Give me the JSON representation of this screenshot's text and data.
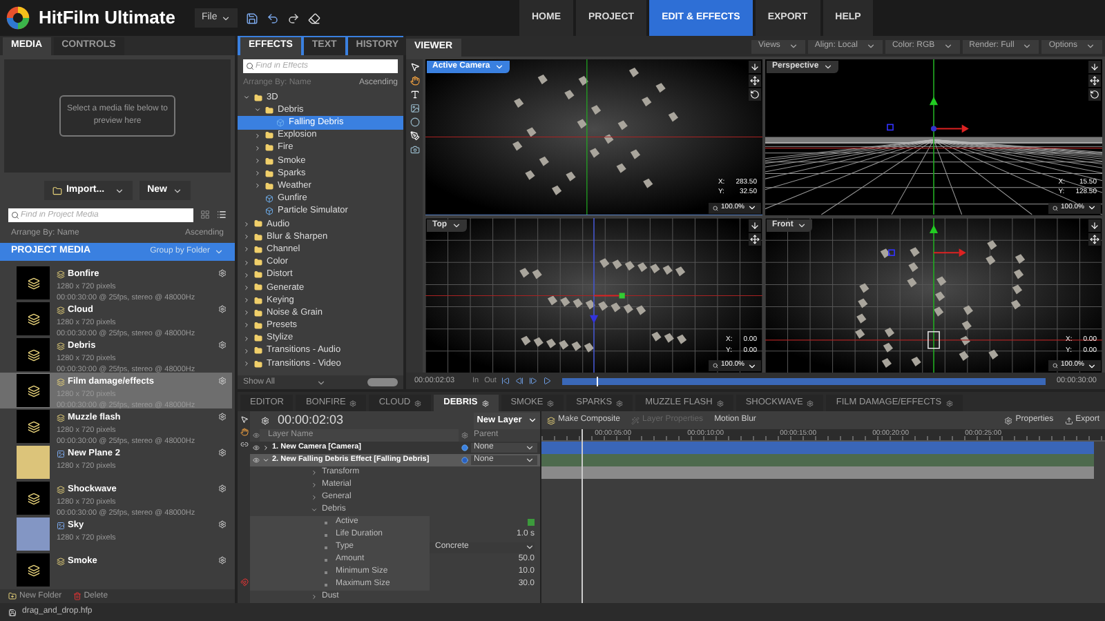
{
  "app": {
    "title": "HitFilm Ultimate",
    "menu": "File"
  },
  "nav": [
    {
      "label": "HOME",
      "selected": false
    },
    {
      "label": "PROJECT",
      "selected": false
    },
    {
      "label": "EDIT & EFFECTS",
      "selected": true
    },
    {
      "label": "EXPORT",
      "selected": false
    },
    {
      "label": "HELP",
      "selected": false
    }
  ],
  "media_panel": {
    "tabs": [
      {
        "label": "MEDIA",
        "selected": true
      },
      {
        "label": "CONTROLS",
        "selected": false
      }
    ],
    "preview_hint": "Select a media file below to preview here",
    "import_button": "Import...",
    "new_button": "New",
    "search": {
      "placeholder": "Find in Project Media"
    },
    "arrange": "Arrange By: Name",
    "order": "Ascending",
    "header": "PROJECT MEDIA",
    "group": "Group by Folder",
    "items": [
      {
        "name": "Bonfire",
        "kind": "composite",
        "resolution": "1280 x 720 pixels",
        "details": "00:00:30:00 @ 25fps, stereo @ 48000Hz",
        "selected": false
      },
      {
        "name": "Cloud",
        "kind": "composite",
        "resolution": "1280 x 720 pixels",
        "details": "00:00:30:00 @ 25fps, stereo @ 48000Hz",
        "selected": false
      },
      {
        "name": "Debris",
        "kind": "composite",
        "resolution": "1280 x 720 pixels",
        "details": "00:00:30:00 @ 25fps, stereo @ 48000Hz",
        "selected": false
      },
      {
        "name": "Film damage/effects",
        "kind": "composite",
        "resolution": "1280 x 720 pixels",
        "details": "00:00:30:00 @ 25fps, stereo @ 48000Hz",
        "selected": true
      },
      {
        "name": "Muzzle flash",
        "kind": "composite",
        "resolution": "1280 x 720 pixels",
        "details": "00:00:30:00 @ 25fps, stereo @ 48000Hz",
        "selected": false
      },
      {
        "name": "New Plane 2",
        "kind": "plane",
        "color": "#dcc47a",
        "resolution": "1280 x 720 pixels",
        "selected": false
      },
      {
        "name": "Shockwave",
        "kind": "composite",
        "resolution": "1280 x 720 pixels",
        "details": "00:00:30:00 @ 25fps, stereo @ 48000Hz",
        "selected": false
      },
      {
        "name": "Sky",
        "kind": "plane",
        "color": "#8396c4",
        "resolution": "1280 x 720 pixels",
        "selected": false
      },
      {
        "name": "Smoke",
        "kind": "composite",
        "selected": false
      }
    ],
    "footer": [
      "New Folder",
      "Delete"
    ]
  },
  "effects_panel": {
    "tabs": [
      {
        "label": "EFFECTS",
        "selected": true
      },
      {
        "label": "TEXT",
        "selected": false
      },
      {
        "label": "HISTORY",
        "selected": false
      }
    ],
    "search": {
      "placeholder": "Find in Effects"
    },
    "arrange": "Arrange By: Name",
    "order": "Ascending",
    "tree": [
      {
        "label": "3D",
        "kind": "folder",
        "expanded": true,
        "selected": false,
        "children": [
          {
            "label": "Debris",
            "kind": "folder",
            "expanded": true,
            "selected": false,
            "children": [
              {
                "label": "Falling Debris",
                "kind": "effect",
                "selected": true
              }
            ]
          },
          {
            "label": "Explosion",
            "kind": "folder",
            "expanded": false,
            "selected": false
          },
          {
            "label": "Fire",
            "kind": "folder",
            "expanded": false,
            "selected": false
          },
          {
            "label": "Smoke",
            "kind": "folder",
            "expanded": false,
            "selected": false
          },
          {
            "label": "Sparks",
            "kind": "folder",
            "expanded": false,
            "selected": false
          },
          {
            "label": "Weather",
            "kind": "folder",
            "expanded": false,
            "selected": false
          },
          {
            "label": "Gunfire",
            "kind": "effect",
            "selected": false
          },
          {
            "label": "Particle Simulator",
            "kind": "effect",
            "selected": false
          }
        ]
      },
      {
        "label": "Audio",
        "kind": "folder",
        "expanded": false,
        "selected": false
      },
      {
        "label": "Blur & Sharpen",
        "kind": "folder",
        "expanded": false,
        "selected": false
      },
      {
        "label": "Channel",
        "kind": "folder",
        "expanded": false,
        "selected": false
      },
      {
        "label": "Color",
        "kind": "folder",
        "expanded": false,
        "selected": false
      },
      {
        "label": "Distort",
        "kind": "folder",
        "expanded": false,
        "selected": false
      },
      {
        "label": "Generate",
        "kind": "folder",
        "expanded": false,
        "selected": false
      },
      {
        "label": "Keying",
        "kind": "folder",
        "expanded": false,
        "selected": false
      },
      {
        "label": "Noise & Grain",
        "kind": "folder",
        "expanded": false,
        "selected": false
      },
      {
        "label": "Presets",
        "kind": "folder",
        "expanded": false,
        "selected": false
      },
      {
        "label": "Stylize",
        "kind": "folder",
        "expanded": false,
        "selected": false
      },
      {
        "label": "Transitions - Audio",
        "kind": "folder",
        "expanded": false,
        "selected": false
      },
      {
        "label": "Transitions - Video",
        "kind": "folder",
        "expanded": false,
        "selected": false
      }
    ],
    "filter": "Show All"
  },
  "viewer": {
    "title": "VIEWER",
    "options": [
      "Views",
      "Align: Local",
      "Color: RGB",
      "Render: Full",
      "Options"
    ],
    "viewports": [
      {
        "label": "Active Camera",
        "kind": "camera",
        "selected": true,
        "readout": [
          {
            "axis": "X:",
            "value": "283.50"
          },
          {
            "axis": "Y:",
            "value": "32.50"
          }
        ],
        "zoom": "100.0%"
      },
      {
        "label": "Perspective",
        "kind": "perspective",
        "selected": false,
        "readout": [
          {
            "axis": "X:",
            "value": "15.50"
          },
          {
            "axis": "Y:",
            "value": "128.50"
          }
        ],
        "zoom": "100.0%"
      },
      {
        "label": "Top",
        "kind": "top",
        "selected": false,
        "readout": [
          {
            "axis": "X:",
            "value": "0.00"
          },
          {
            "axis": "Y:",
            "value": "0.00"
          }
        ],
        "zoom": "100.0%"
      },
      {
        "label": "Front",
        "kind": "front",
        "selected": false,
        "readout": [
          {
            "axis": "X:",
            "value": "0.00"
          },
          {
            "axis": "Y:",
            "value": "0.00"
          }
        ],
        "zoom": "100.0%"
      }
    ],
    "transport": {
      "time": "00:00:02:03",
      "in": "In",
      "out": "Out",
      "level": 0.07,
      "end": "00:00:30:00"
    }
  },
  "timeline": {
    "tabs": [
      {
        "label": "EDITOR",
        "selected": false,
        "closable": false
      },
      {
        "label": "BONFIRE",
        "selected": false,
        "closable": true
      },
      {
        "label": "CLOUD",
        "selected": false,
        "closable": true
      },
      {
        "label": "DEBRIS",
        "selected": true,
        "closable": true
      },
      {
        "label": "SMOKE",
        "selected": false,
        "closable": true
      },
      {
        "label": "SPARKS",
        "selected": false,
        "closable": true
      },
      {
        "label": "MUZZLE FLASH",
        "selected": false,
        "closable": true
      },
      {
        "label": "SHOCKWAVE",
        "selected": false,
        "closable": true
      },
      {
        "label": "FILM DAMAGE/EFFECTS",
        "selected": false,
        "closable": true
      }
    ],
    "time": "00:00:02:03",
    "new_layer": "New Layer",
    "tools": [
      {
        "label": "Make Composite",
        "disabled": false
      },
      {
        "label": "Layer Properties",
        "disabled": true
      },
      {
        "label": "Motion Blur",
        "disabled": false
      }
    ],
    "right_tools": [
      "Properties",
      "Export"
    ],
    "columns": [
      "Layer Name",
      "Parent"
    ],
    "layers": [
      {
        "name": "1. New Camera [Camera]",
        "kind": "camera",
        "selected": false,
        "expanded": false,
        "parent": "None"
      },
      {
        "name": "2. New Falling Debris Effect [Falling Debris]",
        "kind": "effect",
        "selected": true,
        "expanded": true,
        "parent": "None",
        "children": [
          {
            "label": "Transform",
            "kind": "group",
            "expanded": false
          },
          {
            "label": "Material",
            "kind": "group",
            "expanded": false
          },
          {
            "label": "General",
            "kind": "group",
            "expanded": false
          },
          {
            "label": "Debris",
            "kind": "group",
            "expanded": true,
            "children": [
              {
                "label": "Active",
                "kind": "checkbox",
                "checked": true
              },
              {
                "label": "Life Duration",
                "kind": "value",
                "value": "1.0 s"
              },
              {
                "label": "Type",
                "kind": "dropdown",
                "value": "Concrete"
              },
              {
                "label": "Amount",
                "kind": "value",
                "value": "50.0"
              },
              {
                "label": "Minimum Size",
                "kind": "value",
                "value": "10.0"
              },
              {
                "label": "Maximum Size",
                "kind": "value",
                "value": "30.0"
              }
            ]
          },
          {
            "label": "Dust",
            "kind": "group",
            "expanded": false
          }
        ]
      }
    ],
    "ruler": [
      "00:00:05:00",
      "00:00:10:00",
      "00:00:15:00",
      "00:00:20:00",
      "00:00:25:00"
    ],
    "level": 0.07
  },
  "status_bar": {
    "file": "drag_and_drop.hfp"
  }
}
